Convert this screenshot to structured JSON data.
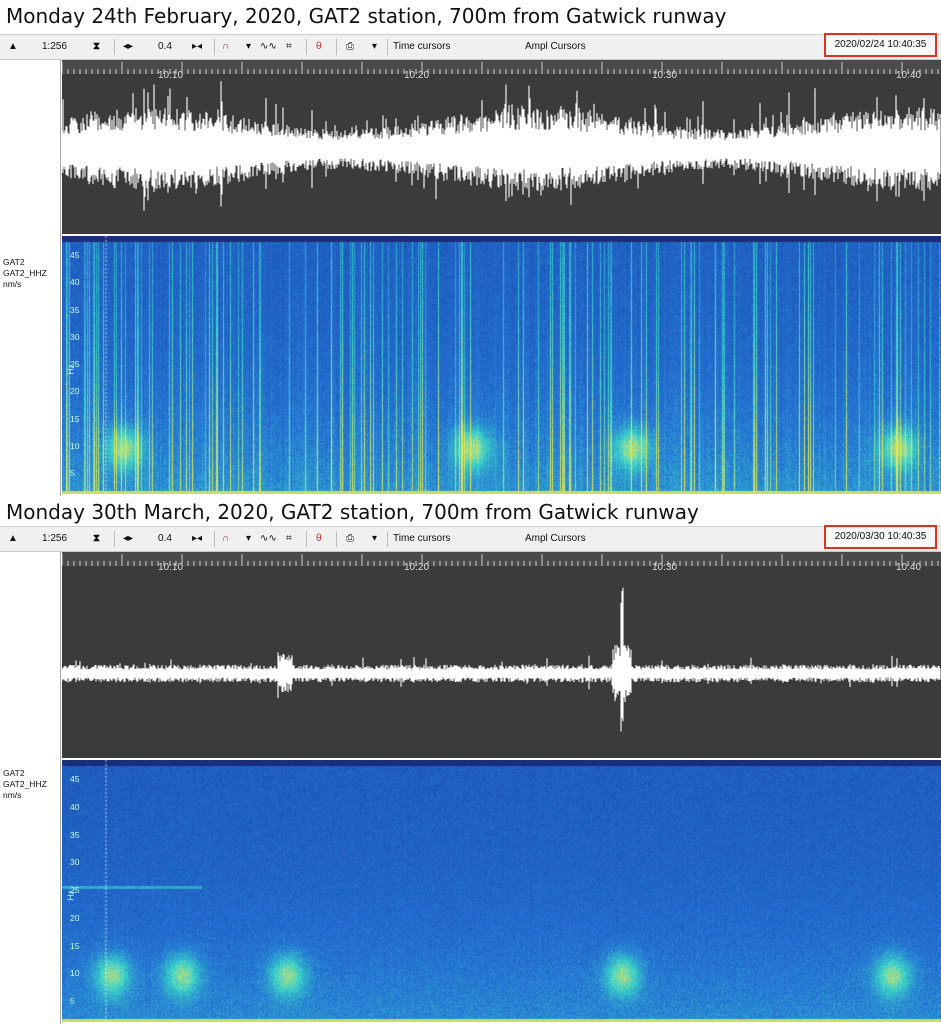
{
  "panels": [
    {
      "title": "Monday 24th February, 2020, GAT2 station, 700m from Gatwick runway",
      "toolbar": {
        "scale_label": "1:256",
        "gain_label": "0.4",
        "time_cursors_label": "Time cursors",
        "ampl_cursors_label": "Ampl Cursors",
        "timestamp": "2020/02/24 10:40:35"
      },
      "channel": {
        "station": "GAT2",
        "component": "GAT2_HHZ",
        "units": "nm/s"
      },
      "time_ticks": [
        "10:10",
        "10:20",
        "10:30",
        "10:40"
      ],
      "hz_ticks": [
        "45",
        "40",
        "35",
        "30",
        "25",
        "20",
        "15",
        "10",
        "5"
      ],
      "y_unit": "Hz"
    },
    {
      "title": "Monday 30th March, 2020, GAT2 station, 700m from Gatwick runway",
      "toolbar": {
        "scale_label": "1:256",
        "gain_label": "0.4",
        "time_cursors_label": "Time cursors",
        "ampl_cursors_label": "Ampl Cursors",
        "timestamp": "2020/03/30 10:40:35"
      },
      "channel": {
        "station": "GAT2",
        "component": "GAT2_HHZ",
        "units": "nm/s"
      },
      "time_ticks": [
        "10:10",
        "10:20",
        "10:30",
        "10:40"
      ],
      "hz_ticks": [
        "45",
        "40",
        "35",
        "30",
        "25",
        "20",
        "15",
        "10",
        "5"
      ],
      "y_unit": "Hz"
    }
  ],
  "colors": {
    "highlight_box": "#e0301e",
    "waveform_bg": "#3b3b3b",
    "waveform_trace": "#ffffff",
    "spectrogram_low": "#1a3a9a",
    "spectrogram_mid": "#2fa6d8",
    "spectrogram_high": "#c8e060"
  },
  "icons": [
    "up-down-arrows-icon",
    "vertical-zoom-icon",
    "horizontal-zoom-icon",
    "filter-icon",
    "wave-icon",
    "fit-icon",
    "spectrum-icon",
    "print-icon",
    "dropdown-icon"
  ]
}
